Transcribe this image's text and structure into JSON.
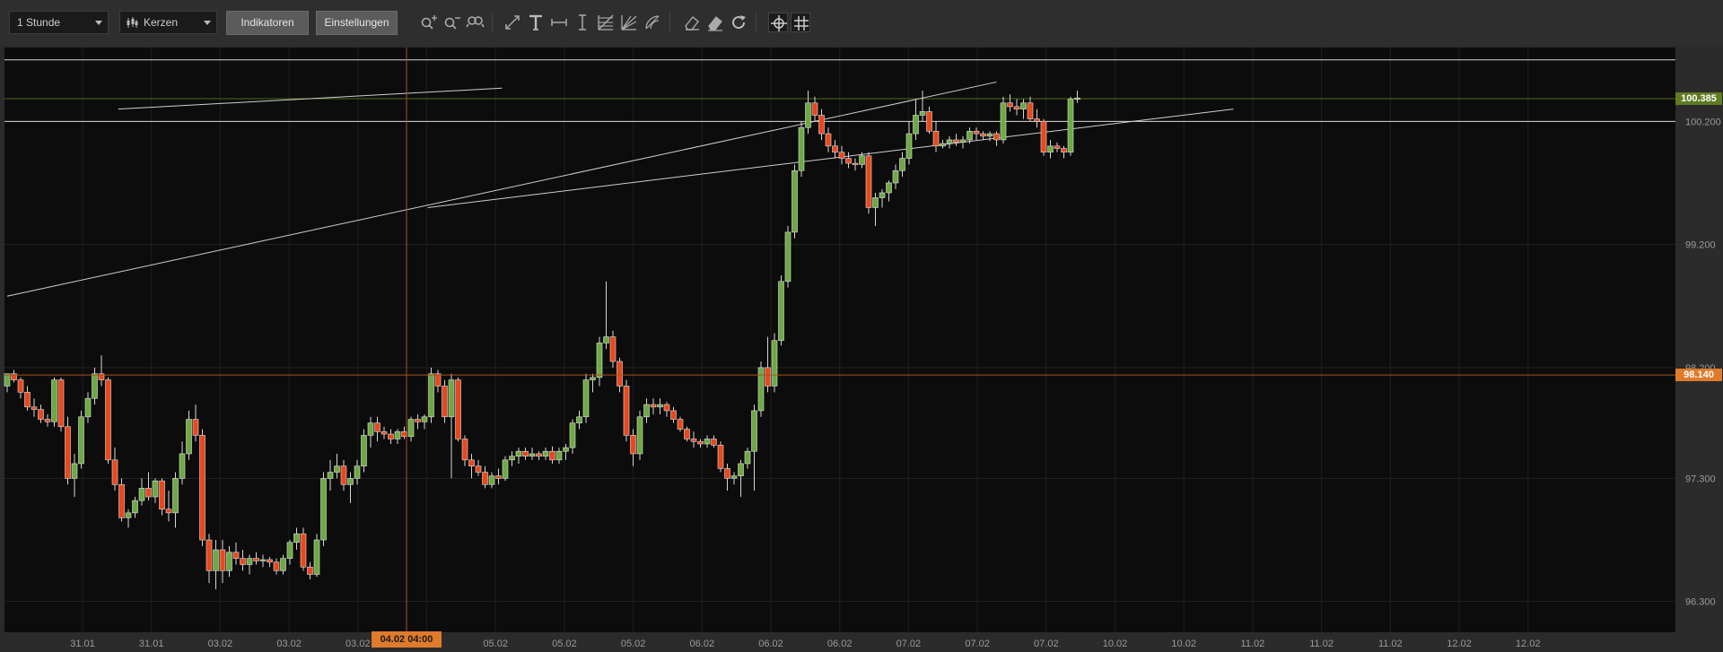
{
  "toolbar": {
    "interval_value": "1 Stunde",
    "chart_type_value": "Kerzen",
    "indicators_label": "Indikatoren",
    "settings_label": "Einstellungen",
    "icons": [
      "zoom-in-icon",
      "zoom-out-icon",
      "zoom-reset-icon",
      "trendline-icon",
      "text-icon",
      "horizontal-line-icon",
      "vertical-line-icon",
      "fibonacci-icon",
      "fan-icon",
      "arc-icon",
      "eraser-icon",
      "clear-all-icon",
      "refresh-icon",
      "crosshair-icon",
      "grid-icon"
    ]
  },
  "price_tags": {
    "last_price": "100.385",
    "crosshair_price": "98.140"
  },
  "time_tag": "04.02 04:00",
  "colors": {
    "background": "#0c0c0c",
    "up": "#6da943",
    "down": "#e8481c",
    "accent": "#e07b2c",
    "last_price_tag": "#5f7c22",
    "crosshair_line": "#a6531b"
  },
  "chart_data": {
    "type": "candlestick",
    "y_ticks": [
      "100.200",
      "99.200",
      "98.200",
      "97.300",
      "96.300"
    ],
    "y_tick_values": [
      100.2,
      99.2,
      98.2,
      97.3,
      96.3
    ],
    "ylim": [
      96.05,
      100.8
    ],
    "x_labels": [
      "31.01",
      "31.01",
      "03.02",
      "03.02",
      "03.02",
      "04.02",
      "05.02",
      "05.02",
      "05.02",
      "06.02",
      "06.02",
      "06.02",
      "07.02",
      "07.02",
      "07.02",
      "10.02",
      "10.02",
      "11.02",
      "11.02",
      "11.02",
      "12.02",
      "12.02"
    ],
    "horizontal_lines": [
      100.7,
      100.2
    ],
    "last_price": 100.385,
    "crosshair_price": 98.14,
    "trendlines": [
      [
        [
          0,
          98.78
        ],
        [
          147,
          100.52
        ]
      ],
      [
        [
          16.5,
          100.3
        ],
        [
          73.5,
          100.47
        ]
      ],
      [
        [
          62.5,
          99.5
        ],
        [
          182.2,
          100.3
        ]
      ]
    ],
    "candles": [
      [
        98.05,
        98.15,
        98.0,
        98.15
      ],
      [
        98.15,
        98.18,
        98.08,
        98.1
      ],
      [
        98.1,
        98.12,
        97.95,
        98.0
      ],
      [
        98.0,
        98.05,
        97.85,
        97.88
      ],
      [
        97.88,
        97.95,
        97.8,
        97.86
      ],
      [
        97.86,
        97.9,
        97.75,
        97.78
      ],
      [
        97.78,
        97.82,
        97.72,
        97.76
      ],
      [
        97.76,
        98.12,
        97.72,
        98.1
      ],
      [
        98.1,
        98.12,
        97.68,
        97.72
      ],
      [
        97.72,
        97.8,
        97.25,
        97.3
      ],
      [
        97.3,
        97.5,
        97.15,
        97.42
      ],
      [
        97.42,
        97.85,
        97.38,
        97.8
      ],
      [
        97.8,
        98.0,
        97.75,
        97.95
      ],
      [
        97.95,
        98.2,
        97.9,
        98.15
      ],
      [
        98.15,
        98.3,
        98.05,
        98.1
      ],
      [
        98.1,
        98.12,
        97.42,
        97.45
      ],
      [
        97.45,
        97.55,
        97.2,
        97.25
      ],
      [
        97.25,
        97.3,
        96.95,
        96.98
      ],
      [
        96.98,
        97.05,
        96.9,
        97.02
      ],
      [
        97.02,
        97.15,
        96.98,
        97.12
      ],
      [
        97.12,
        97.3,
        97.08,
        97.22
      ],
      [
        97.22,
        97.35,
        97.12,
        97.15
      ],
      [
        97.15,
        97.3,
        97.1,
        97.28
      ],
      [
        97.28,
        97.3,
        97.0,
        97.05
      ],
      [
        97.05,
        97.2,
        96.95,
        97.02
      ],
      [
        97.02,
        97.35,
        96.9,
        97.3
      ],
      [
        97.3,
        97.6,
        97.25,
        97.5
      ],
      [
        97.5,
        97.85,
        97.45,
        97.78
      ],
      [
        97.78,
        97.9,
        97.6,
        97.65
      ],
      [
        97.65,
        97.7,
        96.75,
        96.8
      ],
      [
        96.8,
        96.85,
        96.45,
        96.55
      ],
      [
        96.55,
        96.8,
        96.4,
        96.72
      ],
      [
        96.72,
        96.8,
        96.45,
        96.55
      ],
      [
        96.55,
        96.75,
        96.5,
        96.7
      ],
      [
        96.7,
        96.78,
        96.6,
        96.65
      ],
      [
        96.65,
        96.72,
        96.55,
        96.6
      ],
      [
        96.6,
        96.68,
        96.52,
        96.65
      ],
      [
        96.65,
        96.7,
        96.6,
        96.63
      ],
      [
        96.63,
        96.68,
        96.58,
        96.64
      ],
      [
        96.64,
        96.66,
        96.58,
        96.62
      ],
      [
        96.62,
        96.65,
        96.52,
        96.55
      ],
      [
        96.55,
        96.68,
        96.52,
        96.65
      ],
      [
        96.65,
        96.8,
        96.6,
        96.78
      ],
      [
        96.78,
        96.9,
        96.72,
        96.85
      ],
      [
        96.85,
        96.9,
        96.55,
        96.58
      ],
      [
        96.58,
        96.62,
        96.48,
        96.52
      ],
      [
        96.52,
        96.85,
        96.5,
        96.8
      ],
      [
        96.8,
        97.35,
        96.75,
        97.3
      ],
      [
        97.3,
        97.45,
        97.2,
        97.35
      ],
      [
        97.35,
        97.5,
        97.3,
        97.4
      ],
      [
        97.4,
        97.45,
        97.2,
        97.25
      ],
      [
        97.25,
        97.35,
        97.1,
        97.3
      ],
      [
        97.3,
        97.45,
        97.25,
        97.4
      ],
      [
        97.4,
        97.7,
        97.35,
        97.65
      ],
      [
        97.65,
        97.8,
        97.55,
        97.75
      ],
      [
        97.75,
        97.8,
        97.6,
        97.68
      ],
      [
        97.68,
        97.72,
        97.62,
        97.66
      ],
      [
        97.66,
        97.7,
        97.58,
        97.62
      ],
      [
        97.62,
        97.7,
        97.58,
        97.68
      ],
      [
        97.68,
        97.72,
        97.62,
        97.64
      ],
      [
        97.64,
        97.8,
        97.6,
        97.78
      ],
      [
        97.78,
        97.82,
        97.7,
        97.76
      ],
      [
        97.76,
        97.82,
        97.7,
        97.8
      ],
      [
        97.8,
        98.2,
        97.75,
        98.15
      ],
      [
        98.15,
        98.18,
        98.0,
        98.05
      ],
      [
        98.05,
        98.1,
        97.75,
        97.8
      ],
      [
        97.8,
        98.15,
        97.3,
        98.1
      ],
      [
        98.1,
        98.12,
        97.6,
        97.62
      ],
      [
        97.62,
        97.65,
        97.4,
        97.45
      ],
      [
        97.45,
        97.5,
        97.3,
        97.4
      ],
      [
        97.4,
        97.45,
        97.32,
        97.35
      ],
      [
        97.35,
        97.4,
        97.22,
        97.25
      ],
      [
        97.25,
        97.35,
        97.22,
        97.32
      ],
      [
        97.32,
        97.38,
        97.25,
        97.3
      ],
      [
        97.3,
        97.48,
        97.28,
        97.45
      ],
      [
        97.45,
        97.52,
        97.4,
        97.48
      ],
      [
        97.48,
        97.55,
        97.42,
        97.52
      ],
      [
        97.52,
        97.55,
        97.45,
        97.48
      ],
      [
        97.48,
        97.55,
        97.45,
        97.5
      ],
      [
        97.5,
        97.52,
        97.45,
        97.48
      ],
      [
        97.48,
        97.55,
        97.45,
        97.52
      ],
      [
        97.52,
        97.56,
        97.42,
        97.45
      ],
      [
        97.45,
        97.55,
        97.42,
        97.52
      ],
      [
        97.52,
        97.58,
        97.45,
        97.55
      ],
      [
        97.55,
        97.78,
        97.5,
        97.75
      ],
      [
        97.75,
        97.85,
        97.7,
        97.8
      ],
      [
        97.8,
        98.15,
        97.75,
        98.1
      ],
      [
        98.1,
        98.15,
        98.0,
        98.12
      ],
      [
        98.12,
        98.45,
        98.05,
        98.4
      ],
      [
        98.4,
        98.9,
        98.35,
        98.45
      ],
      [
        98.45,
        98.5,
        98.2,
        98.25
      ],
      [
        98.25,
        98.28,
        98.0,
        98.05
      ],
      [
        98.05,
        98.1,
        97.6,
        97.65
      ],
      [
        97.65,
        97.7,
        97.4,
        97.5
      ],
      [
        97.5,
        97.85,
        97.45,
        97.8
      ],
      [
        97.8,
        97.95,
        97.75,
        97.9
      ],
      [
        97.9,
        97.95,
        97.82,
        97.88
      ],
      [
        97.88,
        97.95,
        97.82,
        97.9
      ],
      [
        97.9,
        97.92,
        97.8,
        97.85
      ],
      [
        97.85,
        97.88,
        97.75,
        97.78
      ],
      [
        97.78,
        97.8,
        97.68,
        97.7
      ],
      [
        97.7,
        97.72,
        97.6,
        97.62
      ],
      [
        97.62,
        97.68,
        97.55,
        97.6
      ],
      [
        97.6,
        97.62,
        97.55,
        97.58
      ],
      [
        97.58,
        97.65,
        97.55,
        97.62
      ],
      [
        97.62,
        97.65,
        97.55,
        97.57
      ],
      [
        97.57,
        97.6,
        97.35,
        97.38
      ],
      [
        97.38,
        97.42,
        97.2,
        97.3
      ],
      [
        97.3,
        97.35,
        97.25,
        97.32
      ],
      [
        97.32,
        97.45,
        97.15,
        97.42
      ],
      [
        97.42,
        97.55,
        97.38,
        97.52
      ],
      [
        97.52,
        97.9,
        97.2,
        97.85
      ],
      [
        97.85,
        98.25,
        97.8,
        98.2
      ],
      [
        98.2,
        98.45,
        98.0,
        98.05
      ],
      [
        98.05,
        98.48,
        98.0,
        98.42
      ],
      [
        98.42,
        98.95,
        98.38,
        98.9
      ],
      [
        98.9,
        99.35,
        98.85,
        99.3
      ],
      [
        99.3,
        99.85,
        99.25,
        99.8
      ],
      [
        99.8,
        100.2,
        99.75,
        100.15
      ],
      [
        100.15,
        100.45,
        100.1,
        100.35
      ],
      [
        100.35,
        100.4,
        100.2,
        100.25
      ],
      [
        100.25,
        100.3,
        100.05,
        100.1
      ],
      [
        100.1,
        100.15,
        99.95,
        100.0
      ],
      [
        100.0,
        100.05,
        99.9,
        99.95
      ],
      [
        99.95,
        100.0,
        99.85,
        99.9
      ],
      [
        99.9,
        99.95,
        99.82,
        99.86
      ],
      [
        99.86,
        99.9,
        99.8,
        99.85
      ],
      [
        99.85,
        99.95,
        99.82,
        99.92
      ],
      [
        99.92,
        99.95,
        99.45,
        99.5
      ],
      [
        99.5,
        99.62,
        99.35,
        99.58
      ],
      [
        99.58,
        99.65,
        99.5,
        99.62
      ],
      [
        99.62,
        99.72,
        99.55,
        99.7
      ],
      [
        99.7,
        99.85,
        99.65,
        99.8
      ],
      [
        99.8,
        99.95,
        99.75,
        99.9
      ],
      [
        99.9,
        100.2,
        99.85,
        100.1
      ],
      [
        100.1,
        100.38,
        100.05,
        100.25
      ],
      [
        100.25,
        100.45,
        100.2,
        100.28
      ],
      [
        100.28,
        100.32,
        100.1,
        100.12
      ],
      [
        100.12,
        100.2,
        99.95,
        100.0
      ],
      [
        100.0,
        100.05,
        99.98,
        100.02
      ],
      [
        100.02,
        100.08,
        99.98,
        100.05
      ],
      [
        100.05,
        100.1,
        100.0,
        100.03
      ],
      [
        100.03,
        100.08,
        99.98,
        100.05
      ],
      [
        100.05,
        100.15,
        100.02,
        100.12
      ],
      [
        100.12,
        100.15,
        100.05,
        100.1
      ],
      [
        100.1,
        100.12,
        100.05,
        100.08
      ],
      [
        100.08,
        100.12,
        100.04,
        100.1
      ],
      [
        100.1,
        100.12,
        100.0,
        100.05
      ],
      [
        100.05,
        100.4,
        100.02,
        100.35
      ],
      [
        100.35,
        100.42,
        100.28,
        100.32
      ],
      [
        100.32,
        100.38,
        100.25,
        100.3
      ],
      [
        100.3,
        100.38,
        100.22,
        100.35
      ],
      [
        100.35,
        100.4,
        100.2,
        100.22
      ],
      [
        100.22,
        100.3,
        100.15,
        100.2
      ],
      [
        100.2,
        100.22,
        99.92,
        99.95
      ],
      [
        99.95,
        100.05,
        99.9,
        100.0
      ],
      [
        100.0,
        100.03,
        99.95,
        99.98
      ],
      [
        99.98,
        100.0,
        99.9,
        99.95
      ],
      [
        99.95,
        100.4,
        99.92,
        100.38
      ],
      [
        100.38,
        100.45,
        100.35,
        100.39
      ]
    ]
  }
}
